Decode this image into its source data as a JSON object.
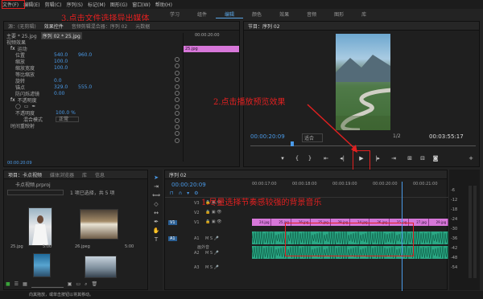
{
  "menu": [
    "文件(F)",
    "编辑(E)",
    "剪辑(C)",
    "序列(S)",
    "标记(M)",
    "图形(G)",
    "窗口(W)",
    "帮助(H)"
  ],
  "workspaces": [
    "学习",
    "组件",
    "编辑",
    "颜色",
    "效果",
    "音频",
    "图形",
    "库"
  ],
  "source_panel": {
    "tabs": [
      "源：(无剪辑)",
      "效果控件",
      "音频剪辑混合器：序列 02",
      "元数据"
    ],
    "clip_path": "主要 * 25.jpg",
    "clip_seq": "序列 02 * 25.jpg",
    "section": "视频效果",
    "fx_motion": "运动",
    "props": [
      {
        "name": "位置",
        "v1": "540.0",
        "v2": "960.0"
      },
      {
        "name": "缩放",
        "v1": "100.0",
        "v2": ""
      },
      {
        "name": "缩放宽度",
        "v1": "100.0",
        "v2": ""
      },
      {
        "name": "等比缩放",
        "v1": "",
        "v2": ""
      },
      {
        "name": "旋转",
        "v1": "0.0",
        "v2": ""
      },
      {
        "name": "锚点",
        "v1": "329.0",
        "v2": "555.0"
      },
      {
        "name": "防闪烁滤镜",
        "v1": "0.00",
        "v2": ""
      }
    ],
    "fx_opacity": "不透明度",
    "opacity_label": "不透明度",
    "opacity_value": "100.0 %",
    "blend_label": "混合模式",
    "blend_value": "正常",
    "remap": "时间重映射",
    "timecode": "00:00:20:09",
    "clip_name": "25.jpg",
    "mini_time": "00:00:20:00"
  },
  "program_panel": {
    "title": "节目：序列 02",
    "timecode": "00:00:20:09",
    "fit": "适合",
    "ratio": "1/2",
    "duration": "00:03:55:17"
  },
  "project_panel": {
    "tabs": [
      "项目：卡点视频",
      "媒体浏览器",
      "库",
      "信息"
    ],
    "file": "卡点视频.prproj",
    "selection": "1 项已选择，共 5 项",
    "items": [
      {
        "name": "25.jpg",
        "dur": "5:00"
      },
      {
        "name": "26.jpeg",
        "dur": "5:00"
      }
    ]
  },
  "timeline": {
    "tab": "序列 02",
    "timecode": "00:00:20:09",
    "ruler": [
      "00:00:17:00",
      "00:00:18:00",
      "00:00:19:00",
      "00:00:20:00",
      "00:00:21:00"
    ],
    "video_tracks": [
      "V3",
      "V2",
      "V1"
    ],
    "audio_tracks": [
      "A1",
      "A2",
      "A3"
    ],
    "src_v": "V1",
    "src_a": "A1",
    "clips": [
      "24.jpg",
      "25.jpg",
      "26.jpg",
      "25.jpg",
      "28.jpg",
      "24.jpg",
      "26.jpg",
      "25.jpg",
      "27.jpg",
      "29.jpg"
    ],
    "audio_label": "画外音",
    "meter": [
      "-6",
      "-12",
      "-18",
      "-24",
      "-30",
      "-36",
      "-42",
      "-48",
      "-54"
    ]
  },
  "status": "向其拖放，或单击按钮以将其移动。",
  "annotations": {
    "a1": "1.尽量选择节奏感较强的背景音乐",
    "a2": "2.点击播放预览效果",
    "a3": "3.点击文件选择导出媒体"
  },
  "colors": {
    "accent": "#4a9ae8",
    "annotation": "#e02020",
    "clip_video": "#d777d9",
    "clip_audio": "#2aa784"
  }
}
